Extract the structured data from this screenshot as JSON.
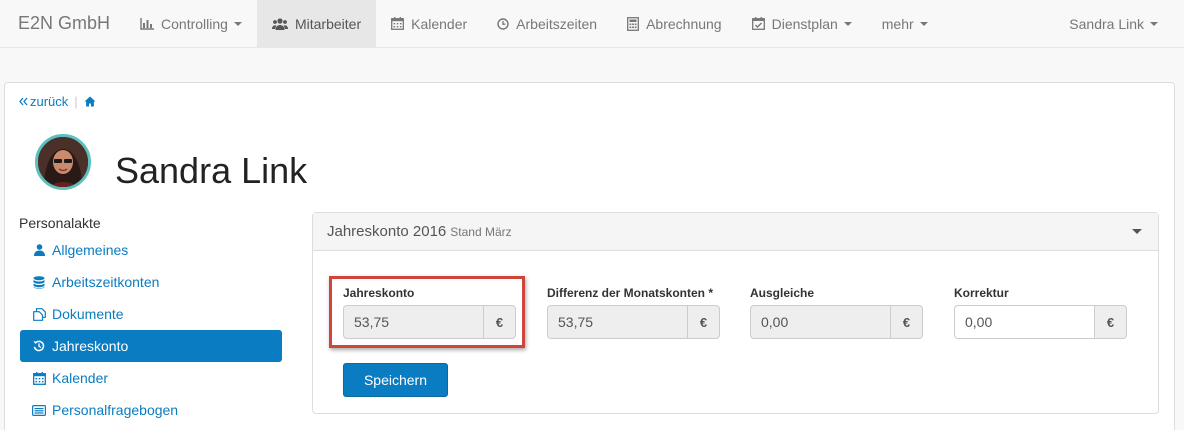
{
  "navbar": {
    "brand": "E2N GmbH",
    "items": [
      {
        "label": "Controlling",
        "icon": "bar-chart-icon",
        "dropdown": true
      },
      {
        "label": "Mitarbeiter",
        "icon": "users-icon",
        "active": true
      },
      {
        "label": "Kalender",
        "icon": "calendar-icon"
      },
      {
        "label": "Arbeitszeiten",
        "icon": "clock-icon"
      },
      {
        "label": "Abrechnung",
        "icon": "calculator-icon"
      },
      {
        "label": "Dienstplan",
        "icon": "calendar-check-icon",
        "dropdown": true
      },
      {
        "label": "mehr",
        "dropdown": true
      }
    ],
    "user": "Sandra Link"
  },
  "breadcrumb": {
    "back": "zurück",
    "home_icon": "home-icon"
  },
  "profile": {
    "name": "Sandra Link"
  },
  "sidebar": {
    "heading": "Personalakte",
    "items": [
      {
        "label": "Allgemeines",
        "icon": "user-icon"
      },
      {
        "label": "Arbeitszeitkonten",
        "icon": "database-icon"
      },
      {
        "label": "Dokumente",
        "icon": "documents-icon"
      },
      {
        "label": "Jahreskonto",
        "icon": "history-icon",
        "active": true
      },
      {
        "label": "Kalender",
        "icon": "calendar-icon"
      },
      {
        "label": "Personalfragebogen",
        "icon": "list-icon"
      }
    ]
  },
  "panel": {
    "title": "Jahreskonto 2016",
    "subtitle": "Stand März",
    "fields": [
      {
        "label": "Jahreskonto",
        "value": "53,75",
        "addon": "€",
        "readonly": true
      },
      {
        "label": "Differenz der Monatskonten *",
        "value": "53,75",
        "addon": "€",
        "readonly": true
      },
      {
        "label": "Ausgleiche",
        "value": "0,00",
        "addon": "€",
        "readonly": true
      },
      {
        "label": "Korrektur",
        "value": "0,00",
        "addon": "€",
        "readonly": false
      }
    ],
    "save_label": "Speichern"
  },
  "colors": {
    "primary": "#0a7cc1",
    "highlight": "#d0453a",
    "avatar_ring": "#5bc0be"
  }
}
